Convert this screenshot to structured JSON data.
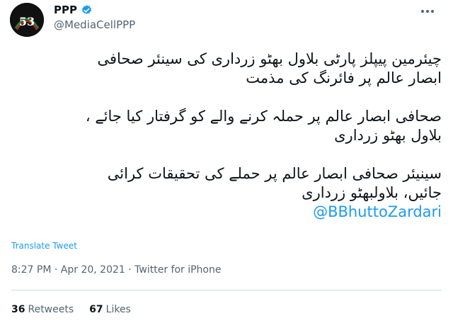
{
  "author": {
    "name": "PPP",
    "handle": "@MediaCellPPP",
    "avatar_number": "53"
  },
  "tweet": {
    "paragraphs": [
      [
        "چیئرمین پیپلز پارٹی بلاول بھٹو زرداری کی سینئر صحافی",
        "ابصار عالم پر فائرنگ کی مذمت"
      ],
      [
        "صحافی ابصار عالم پر حملہ کرنے والے کو گرفتار کیا جائے ،",
        "بلاول بھٹو زرداری"
      ],
      [
        "سینیئر صحافی ابصار عالم پر حملے کی تحقیقات کرائی",
        "جائیں،  بلاولبھٹو زرداری"
      ]
    ],
    "mention": "@BBhuttoZardari"
  },
  "translate_label": "Translate Tweet",
  "meta": {
    "time": "8:27 PM",
    "date": "Apr 20, 2021",
    "source": "Twitter for iPhone",
    "separator": "·"
  },
  "stats": {
    "retweets_count": "36",
    "retweets_label": "Retweets",
    "likes_count": "67",
    "likes_label": "Likes"
  },
  "colors": {
    "accent": "#1d9bf0",
    "secondary_text": "#536471"
  }
}
